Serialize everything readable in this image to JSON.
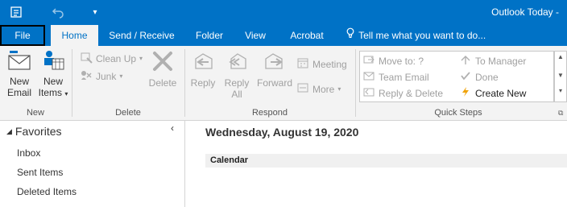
{
  "title_bar": {
    "app_title": "Outlook Today -",
    "qat_icons": [
      "send-receive-icon",
      "undo-icon",
      "customize-qat-icon"
    ]
  },
  "tabs": [
    {
      "label": "File"
    },
    {
      "label": "Home"
    },
    {
      "label": "Send / Receive"
    },
    {
      "label": "Folder"
    },
    {
      "label": "View"
    },
    {
      "label": "Acrobat"
    }
  ],
  "tell_me": {
    "placeholder": "Tell me what you want to do..."
  },
  "ribbon": {
    "new_group": {
      "label": "New",
      "new_email": {
        "line1": "New",
        "line2": "Email"
      },
      "new_items": {
        "line1": "New",
        "line2": "Items"
      }
    },
    "delete_group": {
      "label": "Delete",
      "clean_up": "Clean Up",
      "junk": "Junk",
      "delete": "Delete"
    },
    "respond_group": {
      "label": "Respond",
      "reply": "Reply",
      "reply_all": {
        "line1": "Reply",
        "line2": "All"
      },
      "forward": "Forward",
      "meeting": "Meeting",
      "more": "More"
    },
    "quick_steps": {
      "label": "Quick Steps",
      "move_to": "Move to: ?",
      "team_email": "Team Email",
      "reply_delete": "Reply & Delete",
      "to_manager": "To Manager",
      "done": "Done",
      "create_new": "Create New"
    }
  },
  "nav": {
    "favorites_title": "Favorites",
    "items": [
      "Inbox",
      "Sent Items",
      "Deleted Items"
    ]
  },
  "main": {
    "date": "Wednesday, August 19, 2020",
    "calendar_label": "Calendar"
  },
  "colors": {
    "brand_blue": "#0072c6",
    "ribbon_bg": "#f3f3f3"
  }
}
